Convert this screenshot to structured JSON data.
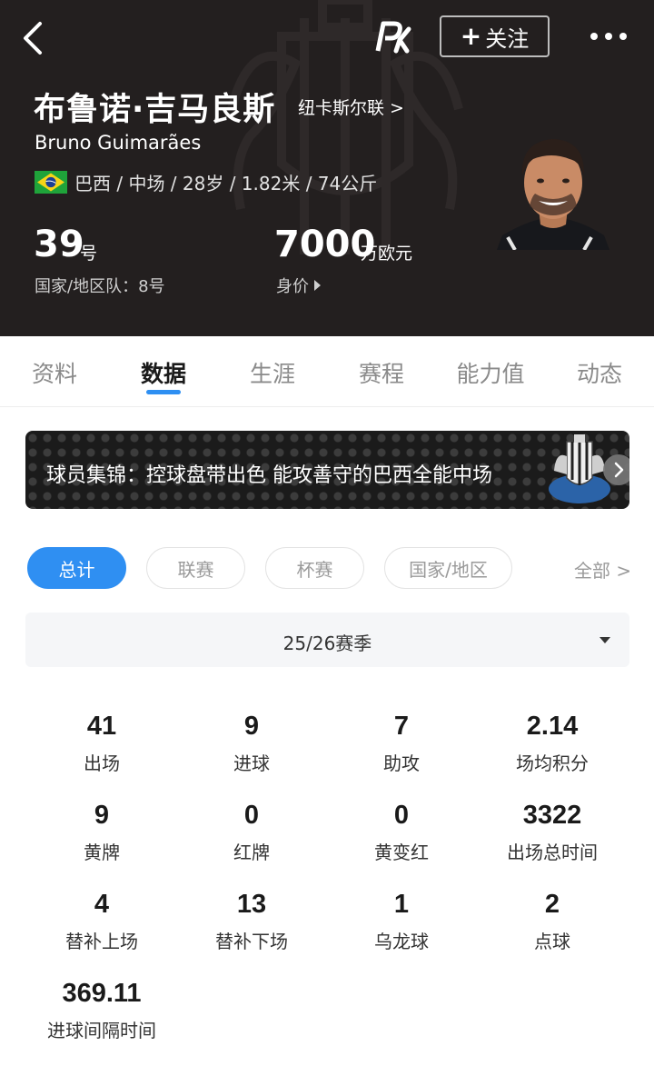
{
  "header": {
    "follow_label": "关注",
    "name_cn": "布鲁诺·吉马良斯",
    "club_link": "纽卡斯尔联 >",
    "name_en": "Bruno Guimarães",
    "info_line": "巴西 / 中场 / 28岁 / 1.82米 / 74公斤",
    "shirt_number": "39",
    "shirt_unit": "号",
    "national_team": "国家/地区队：8号",
    "market_value": "7000",
    "market_value_unit": "万欧元",
    "market_value_label": "身价"
  },
  "tabs": [
    {
      "label": "资料"
    },
    {
      "label": "数据"
    },
    {
      "label": "生涯"
    },
    {
      "label": "赛程"
    },
    {
      "label": "能力值"
    },
    {
      "label": "动态"
    }
  ],
  "active_tab": 1,
  "banner": {
    "text": "球员集锦：控球盘带出色 能攻善守的巴西全能中场"
  },
  "filters": {
    "chips": [
      {
        "label": "总计"
      },
      {
        "label": "联赛"
      },
      {
        "label": "杯赛"
      },
      {
        "label": "国家/地区"
      }
    ],
    "all_label": "全部 >"
  },
  "season": {
    "selected": "25/26赛季"
  },
  "stats": [
    {
      "value": "41",
      "label": "出场"
    },
    {
      "value": "9",
      "label": "进球"
    },
    {
      "value": "7",
      "label": "助攻"
    },
    {
      "value": "2.14",
      "label": "场均积分"
    },
    {
      "value": "9",
      "label": "黄牌"
    },
    {
      "value": "0",
      "label": "红牌"
    },
    {
      "value": "0",
      "label": "黄变红"
    },
    {
      "value": "3322",
      "label": "出场总时间"
    },
    {
      "value": "4",
      "label": "替补上场"
    },
    {
      "value": "13",
      "label": "替补下场"
    },
    {
      "value": "1",
      "label": "乌龙球"
    },
    {
      "value": "2",
      "label": "点球"
    },
    {
      "value": "369.11",
      "label": "进球间隔时间"
    }
  ],
  "colors": {
    "header_bg": "#231f1f",
    "accent": "#2f8ff2"
  },
  "icons": {
    "back": "chevron-left-icon",
    "brand": "pk-logo-icon",
    "more": "more-dots-icon",
    "flag": "brazil-flag-icon",
    "value_arrow": "triangle-right-icon",
    "banner_arrow": "chevron-right-icon",
    "season_caret": "caret-down-icon"
  }
}
